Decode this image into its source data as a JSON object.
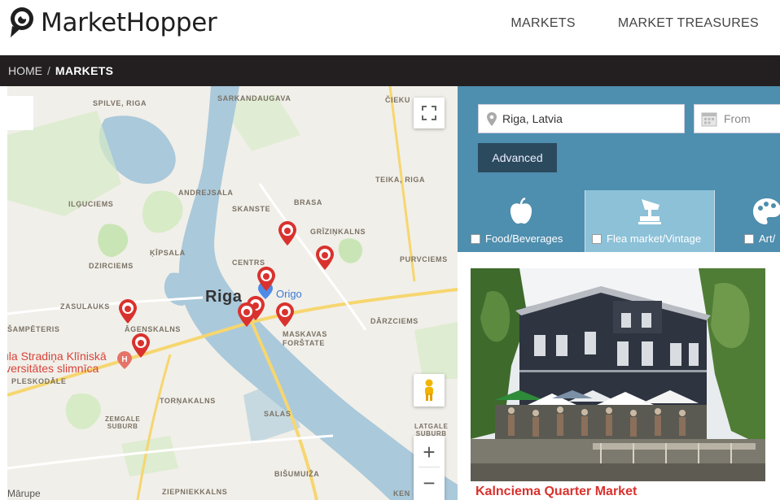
{
  "header": {
    "brand": "MarketHopper",
    "nav": [
      {
        "label": "MARKETS"
      },
      {
        "label": "MARKET TREASURES"
      }
    ]
  },
  "breadcrumb": {
    "home": "HOME",
    "separator": "/",
    "current": "MARKETS"
  },
  "map": {
    "labels": {
      "spilve": "SPILVE, RIGA",
      "sarkandaugava": "SARKANDAUGAVA",
      "cieku": "ČIEKU",
      "teika": "TEIKA, RIGA",
      "ilguciems": "ILĢUCIEMS",
      "andrejsala": "ANDREJSALA",
      "skanste": "SKANSTE",
      "brasa": "BRASA",
      "grizinkalns": "GRĪZIŅKALNS",
      "kipsala": "ĶĪPSALA",
      "centrs": "CENTRS",
      "purvciems": "PURVCIEMS",
      "dzirciems": "DZIRCIEMS",
      "riga": "Riga",
      "origo": "Origo",
      "zasulauks": "ZASULAUKS",
      "darzciems": "DĀRZCIEMS",
      "sampeteris": "ŠAMPĒTERIS",
      "agenskalns": "ĀGENSKALNS",
      "maskavas1": "MASKAVAS",
      "maskavas2": "FORŠTATE",
      "hospital1": "ula Stradiņa Klīniskā",
      "hospital2": "iversitātes slimnīca",
      "pleskodale": "PLESKODĀLE",
      "tornakalns": "TORŅAKALNS",
      "zemgale1": "ZEMGALE",
      "zemgale2": "SUBURB",
      "salas": "SALAS",
      "latgale1": "LATGALE",
      "latgale2": "SUBURB",
      "bisumuiza": "BIŠUMUIŽA",
      "marupe": "Mārupe",
      "ziepniekkalns": "ZIEPNIEKKALNS",
      "ken": "KEN"
    },
    "controls": {
      "zoom_in": "+",
      "zoom_out": "−"
    }
  },
  "search": {
    "location_value": "Riga, Latvia",
    "date_placeholder": "From",
    "advanced_label": "Advanced"
  },
  "categories": [
    {
      "label": "Food/Beverages",
      "icon": "apple-icon",
      "selected": false
    },
    {
      "label": "Flea market/Vintage",
      "icon": "gramophone-icon",
      "selected": true
    },
    {
      "label": "Art/",
      "icon": "palette-icon",
      "selected": false
    }
  ],
  "results": [
    {
      "title": "Kalnciema Quarter Market"
    }
  ],
  "colors": {
    "accent_blue": "#4e8eae",
    "active_tab": "#8cc1d8",
    "pin_red": "#d9322e",
    "title_red": "#d9322e",
    "breadcrumb_bg": "#231f20"
  }
}
